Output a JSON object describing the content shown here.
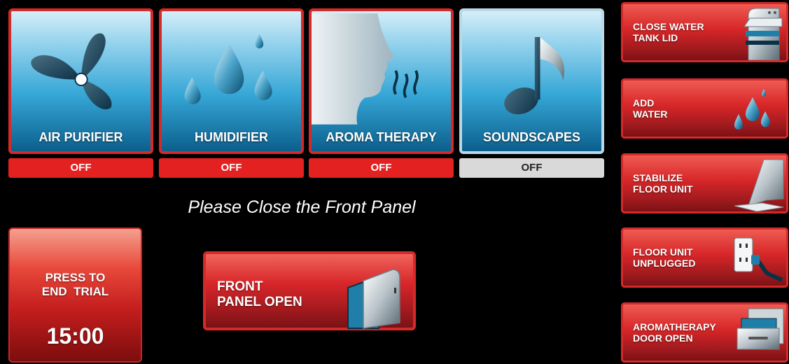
{
  "modes": [
    {
      "label": "AIR PURIFIER",
      "status": "OFF",
      "icon": "fan-icon"
    },
    {
      "label": "HUMIDIFIER",
      "status": "OFF",
      "icon": "water-drops-icon"
    },
    {
      "label": "AROMA THERAPY",
      "status": "OFF",
      "icon": "face-aroma-icon"
    },
    {
      "label": "SOUNDSCAPES",
      "status": "OFF",
      "icon": "music-note-icon"
    }
  ],
  "notice": "Please Close the Front Panel",
  "end_trial": {
    "line1": "PRESS TO",
    "line2": "END  TRIAL",
    "timer": "15:00"
  },
  "front_panel": {
    "line1": "FRONT",
    "line2": "PANEL OPEN",
    "icon": "panel-door-icon"
  },
  "alerts": [
    {
      "line1": "CLOSE WATER",
      "line2": "TANK LID",
      "icon": "water-tank-icon"
    },
    {
      "line1": "ADD",
      "line2": "WATER",
      "icon": "water-drops-icon"
    },
    {
      "line1": "STABILIZE",
      "line2": "FLOOR UNIT",
      "icon": "floor-unit-icon"
    },
    {
      "line1": "FLOOR UNIT",
      "line2": "UNPLUGGED",
      "icon": "outlet-plug-icon"
    },
    {
      "line1": "AROMATHERAPY",
      "line2": "DOOR OPEN",
      "icon": "drawer-icon"
    }
  ],
  "colors": {
    "active_red": "#e32121",
    "inactive_gray": "#d9d9d9",
    "tile_blue": "#35a6d6"
  }
}
